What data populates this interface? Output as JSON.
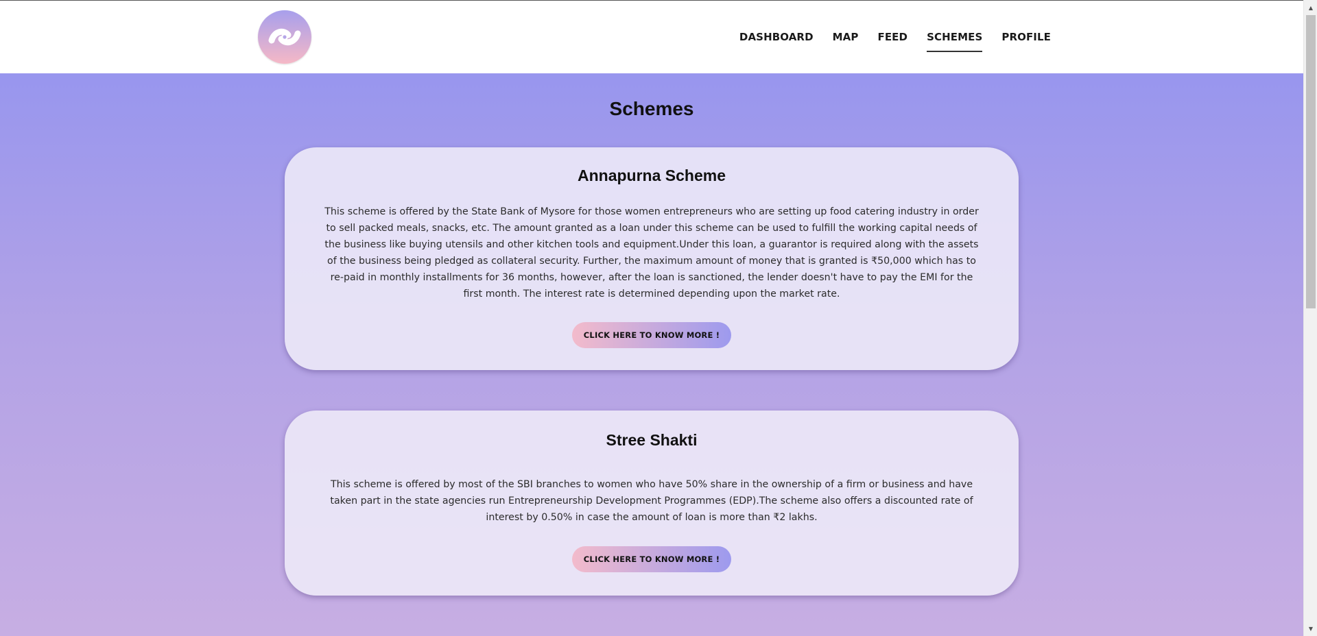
{
  "nav": {
    "logo_icon": "logo-icon",
    "items": [
      {
        "label": "DASHBOARD",
        "active": false
      },
      {
        "label": "MAP",
        "active": false
      },
      {
        "label": "FEED",
        "active": false
      },
      {
        "label": "SCHEMES",
        "active": true
      },
      {
        "label": "PROFILE",
        "active": false
      }
    ]
  },
  "page": {
    "title": "Schemes"
  },
  "schemes": [
    {
      "title": "Annapurna Scheme",
      "description": "This scheme is offered by the State Bank of Mysore for those women entrepreneurs who are setting up food catering industry in order to sell packed meals, snacks, etc. The amount granted as a loan under this scheme can be used to fulfill the working capital needs of the business like buying utensils and other kitchen tools and equipment.Under this loan, a guarantor is required along with the assets of the business being pledged as collateral security. Further, the maximum amount of money that is granted is ₹50,000 which has to re-paid in monthly installments for 36 months, however, after the loan is sanctioned, the lender doesn't have to pay the EMI for the first month. The interest rate is determined depending upon the market rate.",
      "button_label": "CLICK HERE TO KNOW MORE !"
    },
    {
      "title": "Stree Shakti",
      "description": "This scheme is offered by most of the SBI branches to women who have 50% share in the ownership of a firm or business and have taken part in the state agencies run Entrepreneurship Development Programmes (EDP).The scheme also offers a discounted rate of interest by 0.50% in case the amount of loan is more than ₹2 lakhs.",
      "button_label": "CLICK HERE TO KNOW MORE !"
    }
  ],
  "colors": {
    "background_top": "#9896ee",
    "background_bottom": "#c7aee3",
    "button_gradient_start": "#f3bbcb",
    "button_gradient_end": "#9d9aee"
  }
}
